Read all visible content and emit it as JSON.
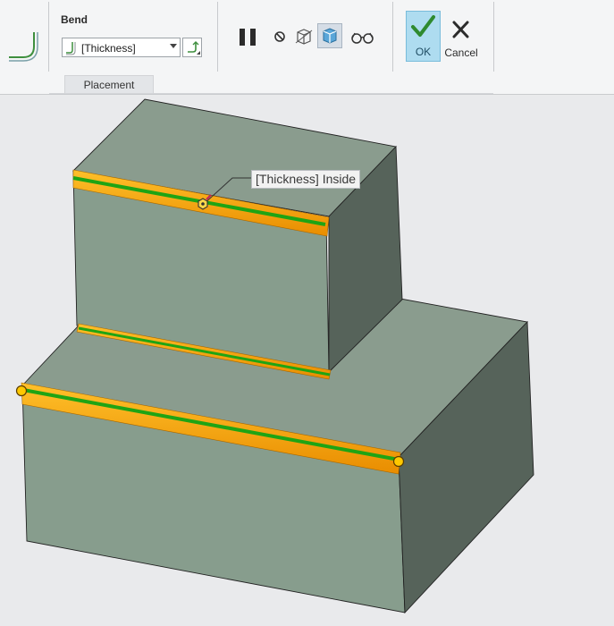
{
  "ribbon": {
    "group_title": "Bend",
    "thickness_combo": {
      "value": "[Thickness]"
    },
    "tabs": [
      {
        "label": "Placement"
      }
    ],
    "ok_label": "OK",
    "cancel_label": "Cancel",
    "icons": {
      "feature": "bend-feature-icon",
      "combo": "bend-radius-icon",
      "flip": "flip-direction-icon",
      "pause": "pause-icon",
      "no_preview": "no-preview-icon",
      "preview_geometry": "preview-geometry-icon",
      "verify": "verify-mode-icon",
      "glasses": "glasses-icon",
      "ok": "check-icon",
      "cancel": "close-icon"
    }
  },
  "model": {
    "dimension_label": "[Thickness] Inside",
    "colors": {
      "face_top": "#8a9c8e",
      "face_front": "#879d8d",
      "face_side": "#56635a",
      "highlight_orange": "#f7a400",
      "highlight_green": "#1fa414",
      "background": "#e9eaec"
    }
  }
}
